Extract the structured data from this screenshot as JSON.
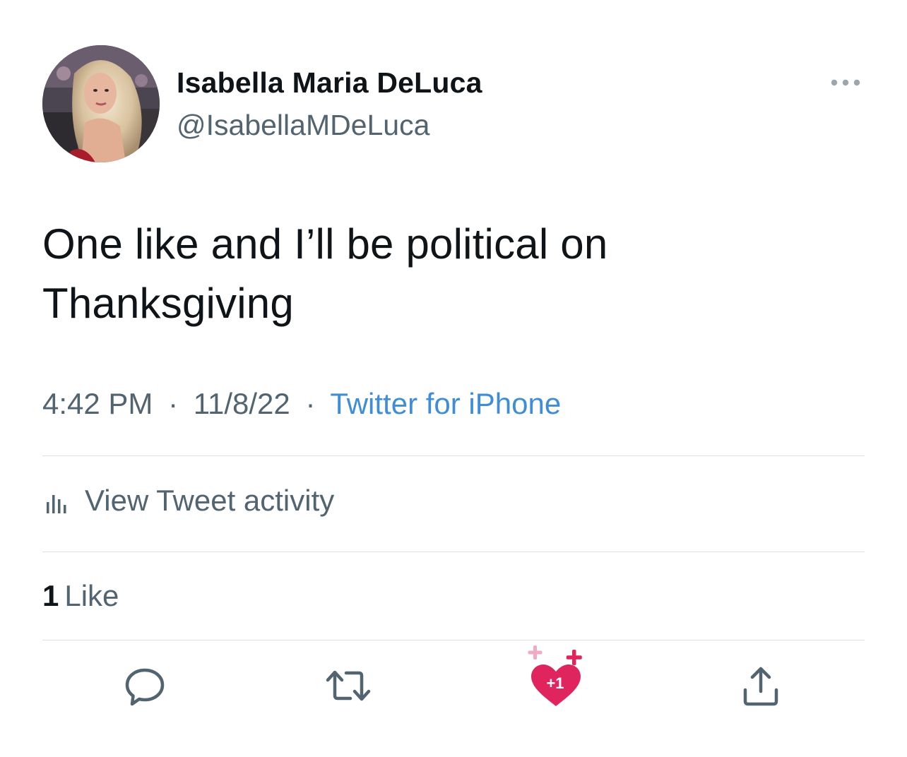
{
  "author": {
    "display_name": "Isabella Maria DeLuca",
    "handle": "@IsabellaMDeLuca",
    "avatar_icon": "profile-photo"
  },
  "menu": {
    "icon": "more-horizontal-icon"
  },
  "tweet": {
    "text": "One like and I’ll be political on Thanksgiving"
  },
  "meta": {
    "time": "4:42 PM",
    "separator": "·",
    "date": "11/8/22",
    "source": "Twitter for iPhone",
    "source_color": "#3f8dd6"
  },
  "activity": {
    "icon": "bar-chart-icon",
    "label": "View Tweet activity"
  },
  "likes": {
    "count": "1",
    "label": "Like"
  },
  "actions": {
    "reply_icon": "reply-icon",
    "retweet_icon": "retweet-icon",
    "like_icon": "heart-icon",
    "like_badge": "+1",
    "like_color": "#e0245e",
    "share_icon": "share-icon"
  },
  "colors": {
    "primary_text": "#0f1419",
    "secondary_text": "#536471",
    "divider": "#dcdfe3"
  }
}
